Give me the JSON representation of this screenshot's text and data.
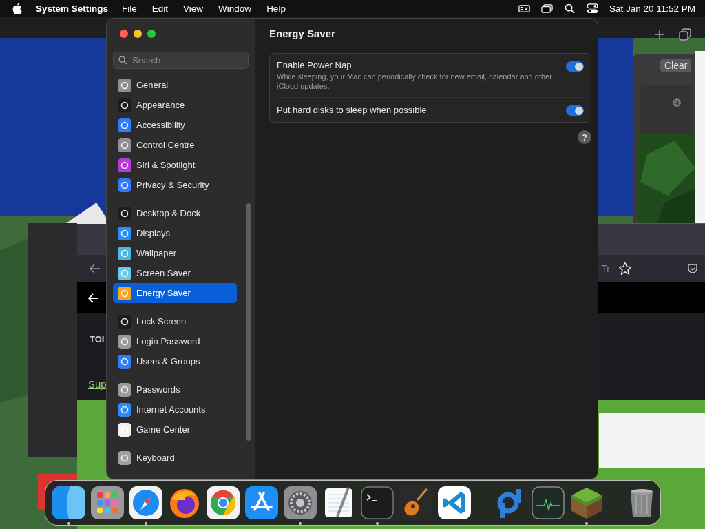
{
  "menu_bar": {
    "app_name": "System Settings",
    "menus": [
      "File",
      "Edit",
      "View",
      "Window",
      "Help"
    ],
    "clock": "Sat Jan 20  11:52 PM"
  },
  "background": {
    "clear_button": "Clear",
    "url_fragment": "-Tr",
    "heading_fragment": "TOI",
    "link_fragment": "Sup"
  },
  "settings": {
    "search": {
      "placeholder": "Search"
    },
    "groups": [
      {
        "items": [
          {
            "label": "General",
            "selected": false,
            "color": "#8e8e93"
          },
          {
            "label": "Appearance",
            "selected": false,
            "color": "#1c1c1e"
          },
          {
            "label": "Accessibility",
            "selected": false,
            "color": "#2f7cf6"
          },
          {
            "label": "Control Centre",
            "selected": false,
            "color": "#8e8e93"
          },
          {
            "label": "Siri & Spotlight",
            "selected": false,
            "color": "#b83ad6"
          },
          {
            "label": "Privacy & Security",
            "selected": false,
            "color": "#3478f6"
          }
        ]
      },
      {
        "items": [
          {
            "label": "Desktop & Dock",
            "selected": false,
            "color": "#1c1c1e"
          },
          {
            "label": "Displays",
            "selected": false,
            "color": "#2f8cf6"
          },
          {
            "label": "Wallpaper",
            "selected": false,
            "color": "#4cb8e6"
          },
          {
            "label": "Screen Saver",
            "selected": false,
            "color": "#6ac8e8"
          },
          {
            "label": "Energy Saver",
            "selected": true,
            "color": "#f5a623"
          }
        ]
      },
      {
        "items": [
          {
            "label": "Lock Screen",
            "selected": false,
            "color": "#1c1c1e"
          },
          {
            "label": "Login Password",
            "selected": false,
            "color": "#9a9a9e"
          },
          {
            "label": "Users & Groups",
            "selected": false,
            "color": "#2f7cf6"
          }
        ]
      },
      {
        "items": [
          {
            "label": "Passwords",
            "selected": false,
            "color": "#9a9a9e"
          },
          {
            "label": "Internet Accounts",
            "selected": false,
            "color": "#2f8cf6"
          },
          {
            "label": "Game Center",
            "selected": false,
            "color": "#f2f2f2"
          }
        ]
      },
      {
        "items": [
          {
            "label": "Keyboard",
            "selected": false,
            "color": "#a0a0a4"
          }
        ]
      }
    ],
    "page_title": "Energy Saver",
    "options": [
      {
        "label": "Enable Power Nap",
        "description": "While sleeping, your Mac can periodically check for new email, calendar and other iCloud updates.",
        "on": true
      },
      {
        "label": "Put hard disks to sleep when possible",
        "on": true
      }
    ],
    "help": "?"
  },
  "dock": [
    {
      "kind": "finder",
      "running": true
    },
    {
      "kind": "launchpad",
      "running": false
    },
    {
      "kind": "safari",
      "running": true
    },
    {
      "kind": "firefox",
      "running": false
    },
    {
      "kind": "chrome",
      "running": false
    },
    {
      "kind": "appstore",
      "running": false
    },
    {
      "kind": "settings",
      "running": true
    },
    {
      "kind": "textedit",
      "running": false
    },
    {
      "kind": "terminal",
      "running": true
    },
    {
      "kind": "guitar",
      "running": false
    },
    {
      "kind": "vscode",
      "running": false
    },
    {
      "kind": "divider"
    },
    {
      "kind": "pd",
      "running": false
    },
    {
      "kind": "activity",
      "running": false
    },
    {
      "kind": "grassblock",
      "running": true
    },
    {
      "kind": "divider"
    },
    {
      "kind": "trash",
      "running": false
    }
  ]
}
